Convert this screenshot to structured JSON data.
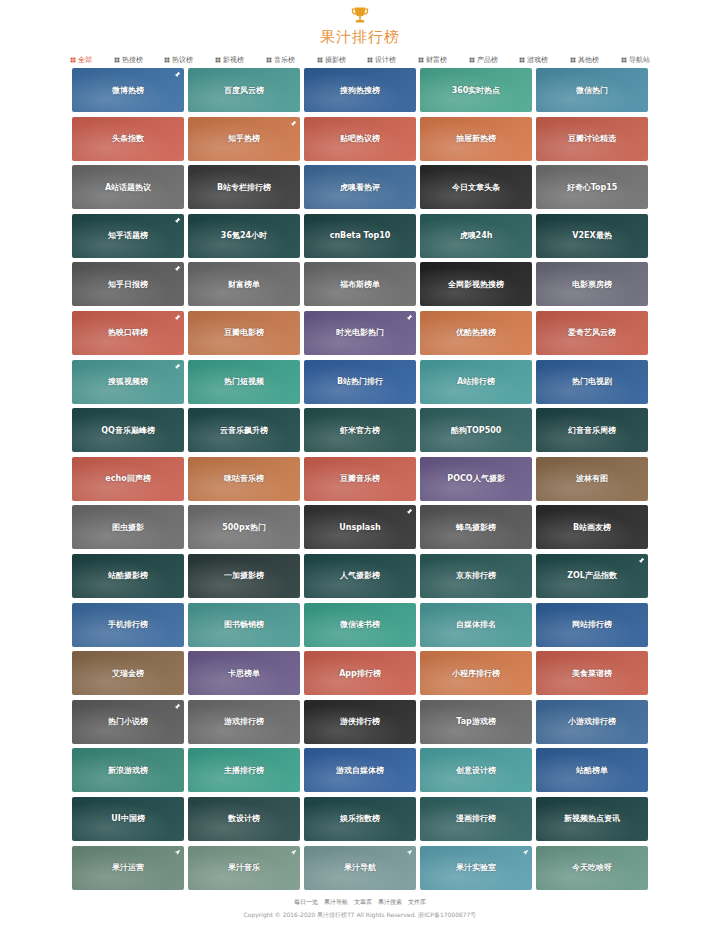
{
  "site": {
    "title": "果汁排行榜"
  },
  "nav": [
    {
      "label": "全部",
      "selected": true
    },
    {
      "label": "热搜榜",
      "selected": false
    },
    {
      "label": "热议榜",
      "selected": false
    },
    {
      "label": "影视榜",
      "selected": false
    },
    {
      "label": "音乐榜",
      "selected": false
    },
    {
      "label": "摄影榜",
      "selected": false
    },
    {
      "label": "设计榜",
      "selected": false
    },
    {
      "label": "财富榜",
      "selected": false
    },
    {
      "label": "产品榜",
      "selected": false
    },
    {
      "label": "游戏榜",
      "selected": false
    },
    {
      "label": "其他榜",
      "selected": false
    },
    {
      "label": "导航站",
      "selected": false
    }
  ],
  "cards": [
    {
      "label": "微博热榜",
      "color": "#3b6fa5",
      "mark": "hot"
    },
    {
      "label": "百度风云榜",
      "color": "#4a9a94",
      "mark": "none"
    },
    {
      "label": "搜狗热搜榜",
      "color": "#2f5f9a",
      "mark": "none"
    },
    {
      "label": "360实时热点",
      "color": "#4aa890",
      "mark": "none"
    },
    {
      "label": "微信热门",
      "color": "#4a8fa8",
      "mark": "none"
    },
    {
      "label": "头条指数",
      "color": "#d06050",
      "mark": "none"
    },
    {
      "label": "知乎热榜",
      "color": "#d0784a",
      "mark": "hot"
    },
    {
      "label": "贴吧热议榜",
      "color": "#d0624f",
      "mark": "none"
    },
    {
      "label": "抽屉新热榜",
      "color": "#d8784a",
      "mark": "none"
    },
    {
      "label": "豆瓣讨论精选",
      "color": "#c9604e",
      "mark": "none"
    },
    {
      "label": "A站话题热议",
      "color": "#6a6a6a",
      "mark": "none"
    },
    {
      "label": "B站专栏排行榜",
      "color": "#3a3a3a",
      "mark": "none"
    },
    {
      "label": "虎嗅看热评",
      "color": "#3d6a9a",
      "mark": "none"
    },
    {
      "label": "今日文章头条",
      "color": "#2a2a2a",
      "mark": "none"
    },
    {
      "label": "好奇心Top15",
      "color": "#707070",
      "mark": "none"
    },
    {
      "label": "知乎话题榜",
      "color": "#1f4a4a",
      "mark": "hot"
    },
    {
      "label": "36氪24小时",
      "color": "#1e4848",
      "mark": "none"
    },
    {
      "label": "cnBeta Top10",
      "color": "#1d4545",
      "mark": "none"
    },
    {
      "label": "虎嗅24h",
      "color": "#2a5f5c",
      "mark": "none"
    },
    {
      "label": "V2EX最热",
      "color": "#1c4444",
      "mark": "none"
    },
    {
      "label": "知乎日报榜",
      "color": "#5a5a5a",
      "mark": "hot"
    },
    {
      "label": "财富榜单",
      "color": "#6a6a6a",
      "mark": "none"
    },
    {
      "label": "福布斯榜单",
      "color": "#6a6a6a",
      "mark": "none"
    },
    {
      "label": "全网影视热搜榜",
      "color": "#222222",
      "mark": "none"
    },
    {
      "label": "电影票房榜",
      "color": "#6a6a78",
      "mark": "none"
    },
    {
      "label": "热映口碑榜",
      "color": "#cc5f4e",
      "mark": "hot"
    },
    {
      "label": "豆瓣电影榜",
      "color": "#c8784a",
      "mark": "none"
    },
    {
      "label": "时光电影热门",
      "color": "#6a5a8a",
      "mark": "hot"
    },
    {
      "label": "优酷热搜榜",
      "color": "#d47a4a",
      "mark": "none"
    },
    {
      "label": "爱奇艺风云榜",
      "color": "#c95e4d",
      "mark": "none"
    },
    {
      "label": "搜狐视频榜",
      "color": "#4a9a94",
      "mark": "hot"
    },
    {
      "label": "热门短视频",
      "color": "#3aa08a",
      "mark": "none"
    },
    {
      "label": "B站热门排行",
      "color": "#3060a0",
      "mark": "none"
    },
    {
      "label": "A站排行榜",
      "color": "#4aa0a0",
      "mark": "none"
    },
    {
      "label": "热门电视剧",
      "color": "#2f5f9a",
      "mark": "none"
    },
    {
      "label": "QQ音乐巅峰榜",
      "color": "#1f4a4a",
      "mark": "none"
    },
    {
      "label": "云音乐飙升榜",
      "color": "#1f4a4a",
      "mark": "none"
    },
    {
      "label": "虾米官方榜",
      "color": "#24504c",
      "mark": "none"
    },
    {
      "label": "酷狗TOP500",
      "color": "#2f6060",
      "mark": "none"
    },
    {
      "label": "幻音音乐周榜",
      "color": "#1d4444",
      "mark": "none"
    },
    {
      "label": "echo回声榜",
      "color": "#cc6050",
      "mark": "none"
    },
    {
      "label": "咪咕音乐榜",
      "color": "#c87a4a",
      "mark": "none"
    },
    {
      "label": "豆瓣音乐榜",
      "color": "#cc6050",
      "mark": "none"
    },
    {
      "label": "POCO人气摄影",
      "color": "#6a5a8a",
      "mark": "none"
    },
    {
      "label": "波林有图",
      "color": "#8a6a4a",
      "mark": "none"
    },
    {
      "label": "图虫摄影",
      "color": "#6a6a6a",
      "mark": "none"
    },
    {
      "label": "500px热门",
      "color": "#707070",
      "mark": "none"
    },
    {
      "label": "Unsplash",
      "color": "#333333",
      "mark": "hot"
    },
    {
      "label": "蜂鸟摄影榜",
      "color": "#555555",
      "mark": "none"
    },
    {
      "label": "B站画友榜",
      "color": "#2a2a2a",
      "mark": "none"
    },
    {
      "label": "站酷摄影榜",
      "color": "#1d4444",
      "mark": "none"
    },
    {
      "label": "一加摄影榜",
      "color": "#2a3a3a",
      "mark": "none"
    },
    {
      "label": "人气摄影榜",
      "color": "#1f4a4a",
      "mark": "none"
    },
    {
      "label": "京东排行榜",
      "color": "#2a5a58",
      "mark": "none"
    },
    {
      "label": "ZOL产品指数",
      "color": "#1f4a4a",
      "mark": "hot"
    },
    {
      "label": "手机排行榜",
      "color": "#3a6aa0",
      "mark": "none"
    },
    {
      "label": "图书畅销榜",
      "color": "#4a9a94",
      "mark": "none"
    },
    {
      "label": "微信读书榜",
      "color": "#3aa08a",
      "mark": "none"
    },
    {
      "label": "自媒体排名",
      "color": "#4a9a9a",
      "mark": "none"
    },
    {
      "label": "网站排行榜",
      "color": "#2f5f9a",
      "mark": "none"
    },
    {
      "label": "艾瑞金榜",
      "color": "#8a6a4a",
      "mark": "none"
    },
    {
      "label": "卡思榜单",
      "color": "#6a5a8a",
      "mark": "none"
    },
    {
      "label": "App排行榜",
      "color": "#cc5f4e",
      "mark": "none"
    },
    {
      "label": "小程序排行榜",
      "color": "#d47a4a",
      "mark": "none"
    },
    {
      "label": "美食菜谱榜",
      "color": "#c95e4d",
      "mark": "none"
    },
    {
      "label": "热门小说榜",
      "color": "#5a5a5a",
      "mark": "hot"
    },
    {
      "label": "游戏排行榜",
      "color": "#6a6a6a",
      "mark": "none"
    },
    {
      "label": "游侠排行榜",
      "color": "#2a2a2a",
      "mark": "none"
    },
    {
      "label": "Tap游戏榜",
      "color": "#6a6a6a",
      "mark": "none"
    },
    {
      "label": "小游戏排行榜",
      "color": "#3d6a9a",
      "mark": "none"
    },
    {
      "label": "新浪游戏榜",
      "color": "#3a8a7a",
      "mark": "none"
    },
    {
      "label": "主播排行榜",
      "color": "#3aa08a",
      "mark": "none"
    },
    {
      "label": "游戏自媒体榜",
      "color": "#3060a0",
      "mark": "none"
    },
    {
      "label": "创意设计榜",
      "color": "#4aa0a0",
      "mark": "none"
    },
    {
      "label": "站酷榜单",
      "color": "#2f5f9a",
      "mark": "none"
    },
    {
      "label": "UI中国榜",
      "color": "#1f4a4a",
      "mark": "none"
    },
    {
      "label": "数设计榜",
      "color": "#2a4a4a",
      "mark": "none"
    },
    {
      "label": "娱乐指数榜",
      "color": "#1f4a4a",
      "mark": "none"
    },
    {
      "label": "漫画排行榜",
      "color": "#2f6060",
      "mark": "none"
    },
    {
      "label": "新视频热点资讯",
      "color": "#1d4444",
      "mark": "none"
    },
    {
      "label": "果汁运营",
      "color": "#6a8a7a",
      "mark": "link"
    },
    {
      "label": "果汁音乐",
      "color": "#7a9a8a",
      "mark": "link"
    },
    {
      "label": "果汁导航",
      "color": "#7a9a9a",
      "mark": "link"
    },
    {
      "label": "果汁实验室",
      "color": "#5aa0b0",
      "mark": "link"
    },
    {
      "label": "今天吃啥呀",
      "color": "#6a9a8a",
      "mark": "none"
    }
  ],
  "footer": {
    "links": [
      "每日一览",
      "果汁导航",
      "文章库",
      "果汁搜索",
      "文件库"
    ],
    "copyright": "Copyright © 2016-2020 果汁排行榜TT All Rights Reserved. 浙ICP备17000677号"
  }
}
